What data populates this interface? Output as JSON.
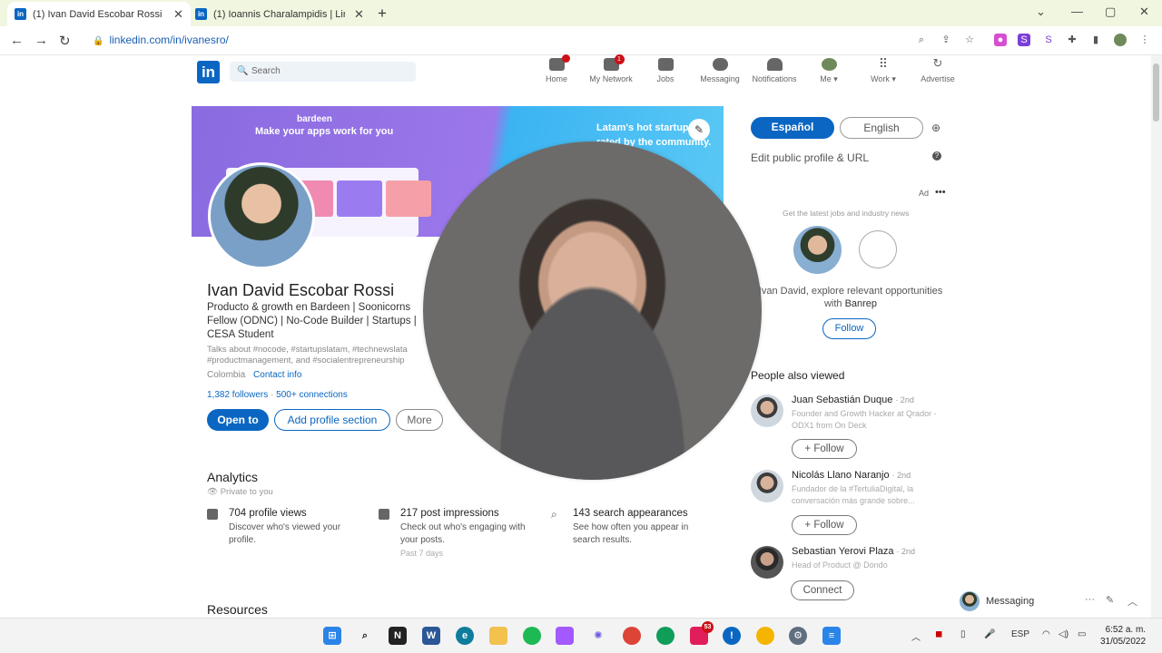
{
  "browser": {
    "tabs": [
      {
        "title": "(1) Ivan David Escobar Rossi | Lir"
      },
      {
        "title": "(1) Ioannis Charalampidis | Linke"
      }
    ],
    "url": "linkedin.com/in/ivanesro/"
  },
  "linkedin_nav": {
    "search_placeholder": "Search",
    "items": [
      {
        "label": "Home",
        "badge": ""
      },
      {
        "label": "My Network",
        "badge": "1"
      },
      {
        "label": "Jobs",
        "badge": ""
      },
      {
        "label": "Messaging",
        "badge": ""
      },
      {
        "label": "Notifications",
        "badge": ""
      },
      {
        "label": "Me ▾",
        "badge": ""
      },
      {
        "label": "Work ▾",
        "badge": ""
      },
      {
        "label": "Advertise",
        "badge": ""
      }
    ]
  },
  "banner": {
    "brand": "bardeen",
    "tagline": "Make your apps work for you",
    "right_text": "Latam's hot startups, rated by the community."
  },
  "profile": {
    "name": "Ivan David Escobar Rossi",
    "headline": "Producto & growth en Bardeen | Soonicorns Fellow (ODNC) | No-Code Builder | Startups | CESA Student",
    "talks_about": "Talks about #nocode, #startupslatam, #technewslata #productmanagement, and #socialentrepreneurship",
    "location": "Colombia",
    "contact_info": "Contact info",
    "followers": "1,382 followers",
    "connections": "500+ connections",
    "buttons": {
      "open_to": "Open to",
      "add_section": "Add profile section",
      "more": "More"
    }
  },
  "analytics": {
    "title": "Analytics",
    "private": "Private to you",
    "stats": [
      {
        "title": "704 profile views",
        "desc": "Discover who's viewed your profile.",
        "period": ""
      },
      {
        "title": "217 post impressions",
        "desc": "Check out who's engaging with your posts.",
        "period": "Past 7 days"
      },
      {
        "title": "143 search appearances",
        "desc": "See how often you appear in search results.",
        "period": ""
      }
    ]
  },
  "resources_title": "Resources",
  "rail": {
    "lang_on": "Español",
    "lang_off": "English",
    "edit_url": "Edit public profile & URL",
    "ad_label": "Ad",
    "ad_sub": "Get the latest jobs and industry news",
    "ad_msg_pre": "Ivan David, explore relevant opportunities with",
    "ad_msg_org": "Banrep",
    "ad_follow": "Follow",
    "pav_title": "People also viewed",
    "people": [
      {
        "name": "Juan Sebastián Duque",
        "degree": "· 2nd",
        "desc": "Founder and Growth Hacker at Qrador - ODX1 from On Deck",
        "action": "+ Follow"
      },
      {
        "name": "Nicolás Llano Naranjo",
        "degree": "· 2nd",
        "desc": "Fundador de la #TertuliaDigital, la conversación más grande sobre...",
        "action": "+ Follow"
      },
      {
        "name": "Sebastian Yerovi Plaza",
        "degree": "· 2nd",
        "desc": "Head of Product @ Dondo",
        "action": "Connect"
      }
    ],
    "messaging": "Messaging"
  },
  "taskbar": {
    "lang": "ESP",
    "time": "6:52 a. m.",
    "date": "31/05/2022",
    "slack_badge": "53"
  }
}
